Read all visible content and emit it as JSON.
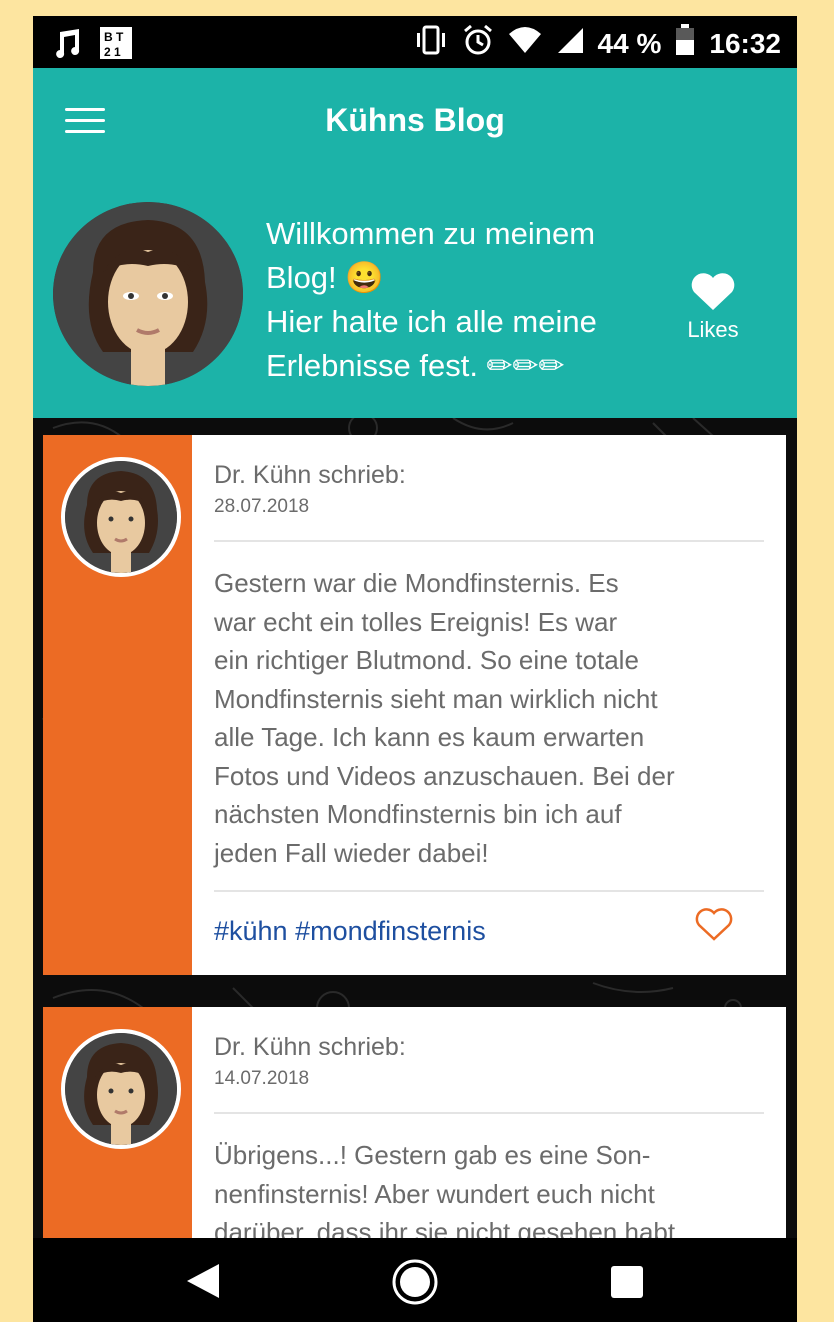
{
  "status_bar": {
    "battery_text": "44 %",
    "time": "16:32",
    "icons": [
      "music-note-icon",
      "bt21-icon",
      "vibrate-icon",
      "alarm-icon",
      "wifi-icon",
      "signal-icon",
      "battery-icon"
    ]
  },
  "app": {
    "title": "Kühns Blog"
  },
  "header": {
    "welcome_line1": "Willkommen zu meinem",
    "welcome_line2": "Blog! 😀",
    "welcome_line3": "Hier halte ich alle meine",
    "welcome_line4": "Erlebnisse fest. ✏✏✏",
    "likes_label": "Likes"
  },
  "posts": [
    {
      "author": "Dr. Kühn schrieb:",
      "date": "28.07.2018",
      "body_lines": [
        "Gestern war die Mondfinsternis. Es",
        "war echt ein tolles Ereignis! Es war",
        "ein richtiger Blutmond. So eine totale",
        "Mondfinsternis sieht man wirklich nicht",
        "alle Tage. Ich kann es kaum erwarten",
        "Fotos und Videos anzuschauen. Bei der",
        "nächsten Mondfinsternis bin ich auf",
        "jeden Fall wieder dabei!"
      ],
      "tags": [
        "#kühn",
        "#mondfinsternis"
      ]
    },
    {
      "author": "Dr. Kühn schrieb:",
      "date": "14.07.2018",
      "body_lines": [
        "Übrigens...! Gestern gab es eine Son-",
        "nenfinsternis! Aber wundert euch nicht",
        "darüber, dass ihr sie nicht gesehen habt"
      ]
    }
  ],
  "colors": {
    "teal": "#1cb3a8",
    "orange": "#ec6b24",
    "tag_blue": "#1e4fa0",
    "page_bg": "#fde5a0"
  }
}
